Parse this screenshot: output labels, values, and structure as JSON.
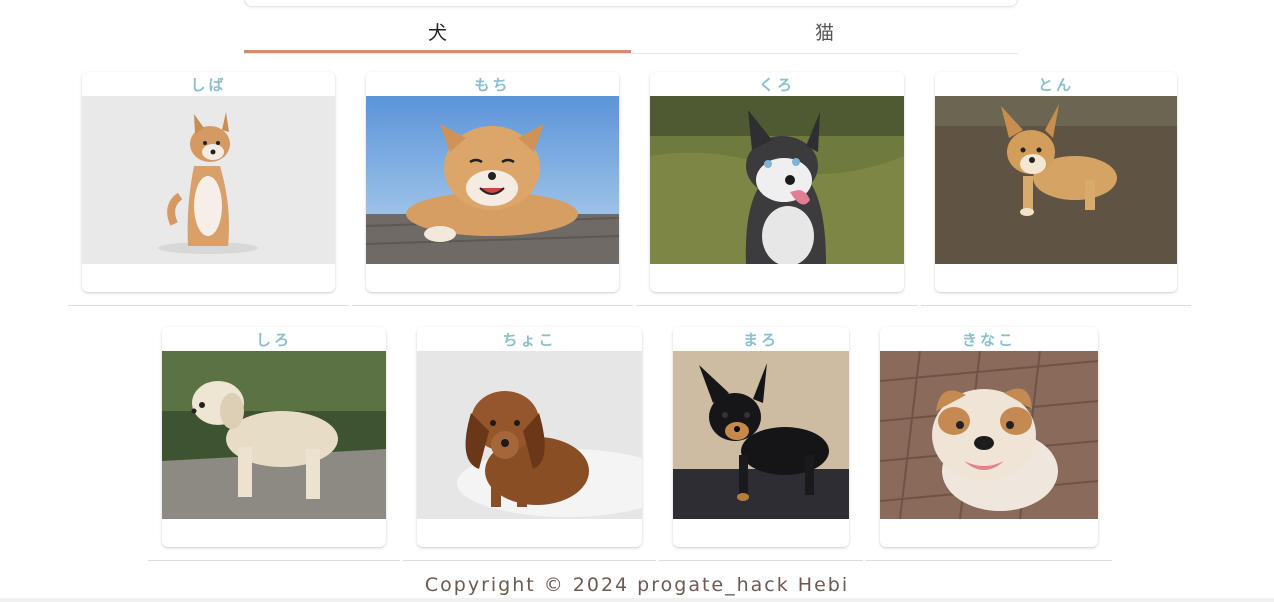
{
  "tabs": [
    {
      "label": "犬",
      "selected": true
    },
    {
      "label": "猫",
      "selected": false
    }
  ],
  "pets": [
    {
      "name": "しば",
      "photo": "shiba-photo"
    },
    {
      "name": "もち",
      "photo": "shiba-smiling-photo"
    },
    {
      "name": "くろ",
      "photo": "husky-photo"
    },
    {
      "name": "とん",
      "photo": "corgi-photo"
    },
    {
      "name": "しろ",
      "photo": "golden-retriever-photo"
    },
    {
      "name": "ちょこ",
      "photo": "dachshund-photo"
    },
    {
      "name": "まろ",
      "photo": "chihuahua-photo"
    },
    {
      "name": "きなこ",
      "photo": "bulldog-photo"
    }
  ],
  "footer": {
    "copyright": "Copyright © 2024 progate_hack Hebi"
  },
  "colors": {
    "tab_indicator": "#d08c74",
    "pet_name": "#8bbfd0",
    "footer_text": "#6a5a52"
  }
}
